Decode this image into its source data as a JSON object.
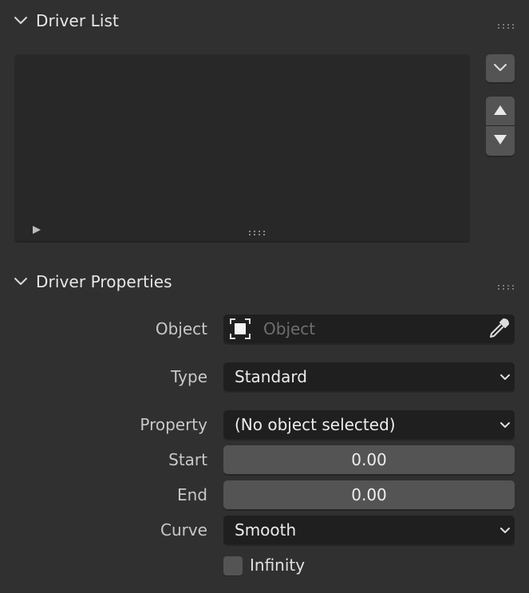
{
  "driver_list": {
    "title": "Driver List"
  },
  "driver_properties": {
    "title": "Driver Properties",
    "object": {
      "label": "Object",
      "placeholder": "Object"
    },
    "type": {
      "label": "Type",
      "value": "Standard"
    },
    "property": {
      "label": "Property",
      "value": "(No object selected)"
    },
    "start": {
      "label": "Start",
      "value": "0.00"
    },
    "end": {
      "label": "End",
      "value": "0.00"
    },
    "curve": {
      "label": "Curve",
      "value": "Smooth"
    },
    "infinity": {
      "label": "Infinity",
      "checked": false
    }
  },
  "icons": {
    "collapse": "chevron-down-icon",
    "grip": "drag-grip-icon",
    "play": "play-triangle-icon",
    "dropdown": "chevron-down-icon",
    "move_up": "triangle-up-icon",
    "move_down": "triangle-down-icon",
    "object": "object-cube-icon",
    "eyedropper": "eyedropper-icon"
  },
  "colors": {
    "background": "#303030",
    "field_dark": "#1f1f1f",
    "field_num": "#545454",
    "list_bg": "#282828"
  }
}
